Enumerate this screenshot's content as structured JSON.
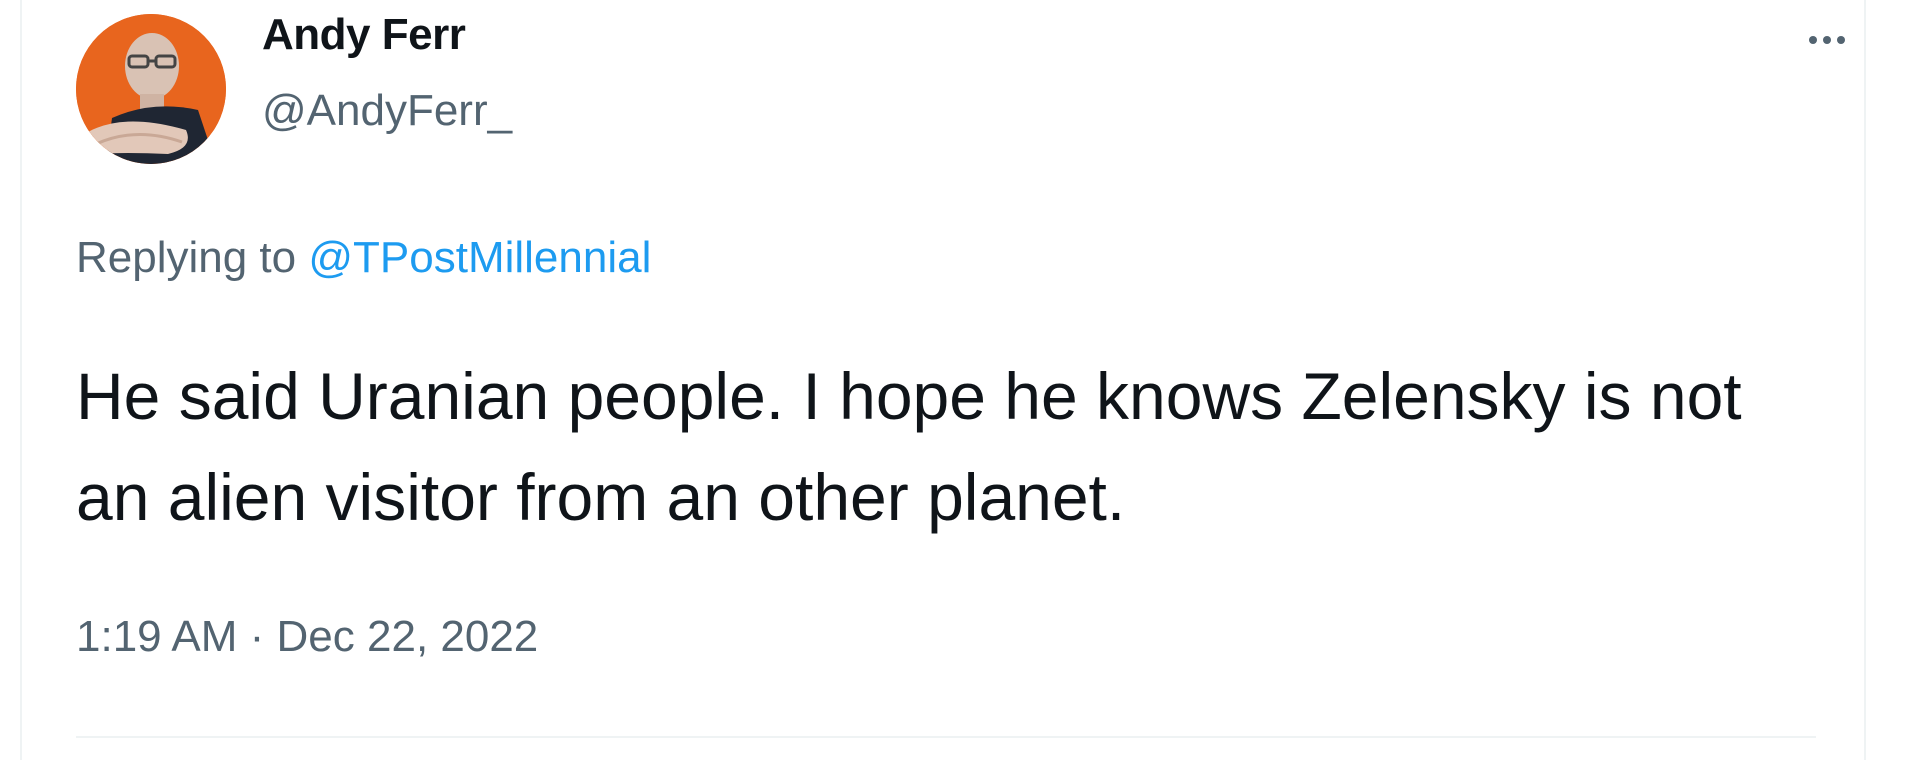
{
  "tweet": {
    "author": {
      "display_name": "Andy Ferr",
      "handle": "@AndyFerr_",
      "avatar_icon": "profile-photo"
    },
    "more_icon": "more-horizontal-icon",
    "reply_prefix": "Replying to ",
    "reply_to": "@TPostMillennial",
    "text": "He said Uranian people. I hope he knows Zelensky is not an alien visitor from an other planet.",
    "timestamp": "1:19 AM · Dec 22, 2022"
  },
  "colors": {
    "text_primary": "#0f1419",
    "text_secondary": "#536471",
    "link": "#1d9bf0",
    "avatar_background": "#e8651e"
  }
}
